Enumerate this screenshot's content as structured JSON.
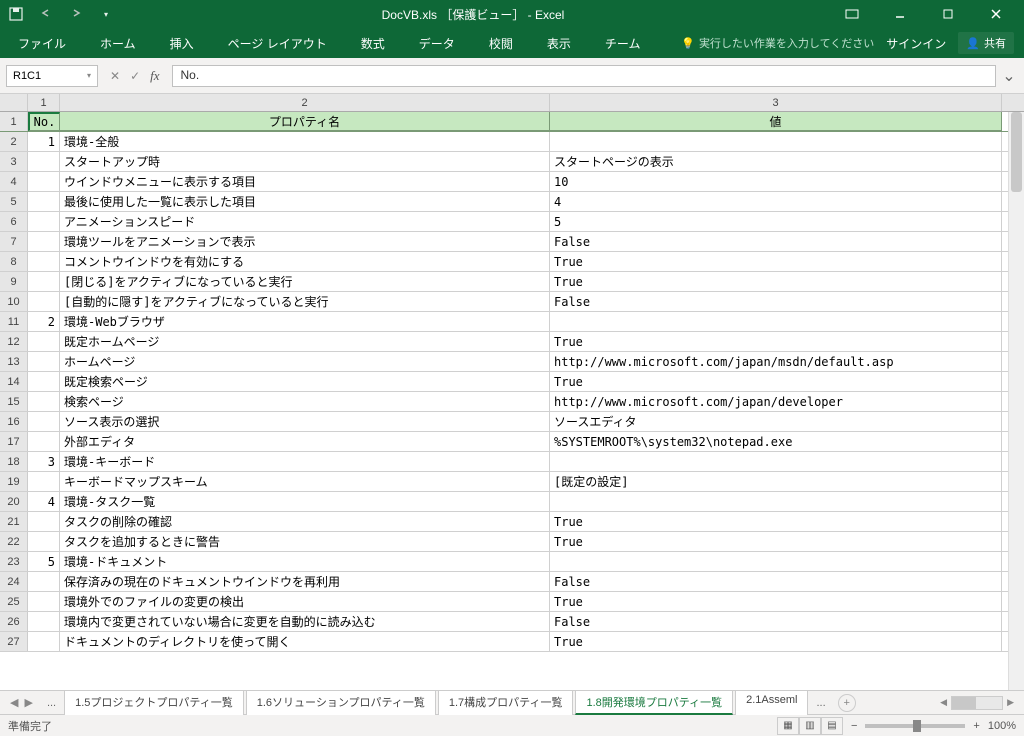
{
  "title": "DocVB.xls ［保護ビュー］ - Excel",
  "ribbon": {
    "tabs": [
      "ファイル",
      "ホーム",
      "挿入",
      "ページ レイアウト",
      "数式",
      "データ",
      "校閲",
      "表示",
      "チーム"
    ],
    "tell_me": "実行したい作業を入力してください",
    "signin": "サインイン",
    "share": "共有"
  },
  "name_box": "R1C1",
  "formula": "No.",
  "col_headers": [
    "1",
    "2",
    "3"
  ],
  "headers": {
    "c1": "No.",
    "c2": "プロパティ名",
    "c3": "値"
  },
  "rows": [
    {
      "no": "1",
      "name": "環境-全般",
      "val": ""
    },
    {
      "no": "",
      "name": "スタートアップ時",
      "val": "スタートページの表示"
    },
    {
      "no": "",
      "name": "ウインドウメニューに表示する項目",
      "val": "10"
    },
    {
      "no": "",
      "name": "最後に使用した一覧に表示した項目",
      "val": "4"
    },
    {
      "no": "",
      "name": "アニメーションスピード",
      "val": "5"
    },
    {
      "no": "",
      "name": "環境ツールをアニメーションで表示",
      "val": "False"
    },
    {
      "no": "",
      "name": "コメントウインドウを有効にする",
      "val": "True"
    },
    {
      "no": "",
      "name": "[閉じる]をアクティブになっていると実行",
      "val": "True"
    },
    {
      "no": "",
      "name": "[自動的に隠す]をアクティブになっていると実行",
      "val": "False"
    },
    {
      "no": "2",
      "name": "環境-Webブラウザ",
      "val": ""
    },
    {
      "no": "",
      "name": "既定ホームページ",
      "val": "True"
    },
    {
      "no": "",
      "name": "ホームページ",
      "val": "http://www.microsoft.com/japan/msdn/default.asp"
    },
    {
      "no": "",
      "name": "既定検索ページ",
      "val": "True"
    },
    {
      "no": "",
      "name": "検索ページ",
      "val": "http://www.microsoft.com/japan/developer"
    },
    {
      "no": "",
      "name": "ソース表示の選択",
      "val": "ソースエディタ"
    },
    {
      "no": "",
      "name": "外部エディタ",
      "val": "%SYSTEMROOT%\\system32\\notepad.exe"
    },
    {
      "no": "3",
      "name": "環境-キーボード",
      "val": ""
    },
    {
      "no": "",
      "name": "キーボードマップスキーム",
      "val": "[既定の設定]"
    },
    {
      "no": "4",
      "name": "環境-タスク一覧",
      "val": ""
    },
    {
      "no": "",
      "name": "タスクの削除の確認",
      "val": "True"
    },
    {
      "no": "",
      "name": "タスクを追加するときに警告",
      "val": "True"
    },
    {
      "no": "5",
      "name": "環境-ドキュメント",
      "val": ""
    },
    {
      "no": "",
      "name": "保存済みの現在のドキュメントウインドウを再利用",
      "val": "False"
    },
    {
      "no": "",
      "name": "環境外でのファイルの変更の検出",
      "val": "True"
    },
    {
      "no": "",
      "name": "環境内で変更されていない場合に変更を自動的に読み込む",
      "val": "False"
    },
    {
      "no": "",
      "name": "ドキュメントのディレクトリを使って開く",
      "val": "True"
    }
  ],
  "sheet_tabs": {
    "list": [
      "1.5プロジェクトプロパティ一覧",
      "1.6ソリューションプロパティ一覧",
      "1.7構成プロパティ一覧",
      "1.8開発環境プロパティ一覧",
      "2.1Asseml"
    ],
    "active_index": 3,
    "overflow": "..."
  },
  "status": {
    "ready": "準備完了",
    "zoom": "100%"
  }
}
